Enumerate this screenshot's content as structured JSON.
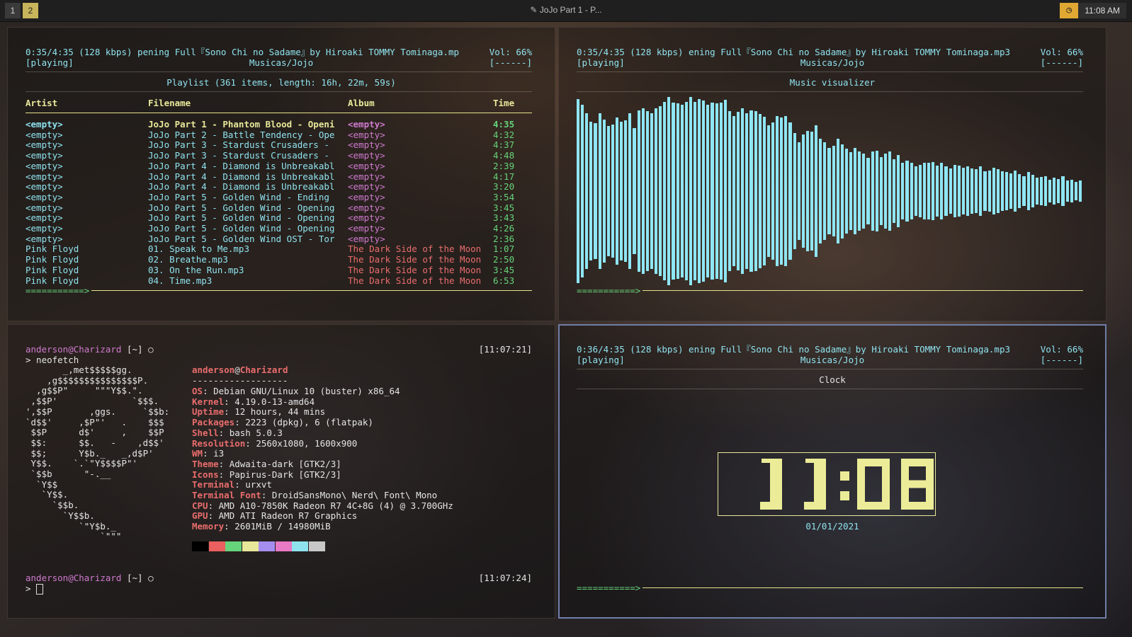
{
  "topbar": {
    "workspaces": [
      "1",
      "2"
    ],
    "window_title": "JoJo Part 1 - P...",
    "time": "11:08 AM",
    "clock_icon": "clock-icon"
  },
  "player_tl": {
    "status_time": "0:35/4:35 (128 kbps)",
    "title": "pening Full『Sono Chi no Sadame』by Hiroaki TOMMY Tominaga.mp",
    "volume": "Vol: 66%",
    "state": "[playing]",
    "dir": "Musicas/Jojo",
    "flags": "[------]",
    "header": "Playlist (361 items, length: 16h, 22m, 59s)",
    "columns": [
      "Artist",
      "Filename",
      "Album",
      "Time"
    ],
    "progress": "===========>",
    "rows": [
      {
        "artist": "<empty>",
        "file": "JoJo Part 1 - Phantom Blood - Openi",
        "album": "<empty>",
        "time": "4:35",
        "current": true
      },
      {
        "artist": "<empty>",
        "file": "JoJo Part 2 - Battle Tendency - Ope",
        "album": "<empty>",
        "time": "4:32"
      },
      {
        "artist": "<empty>",
        "file": "JoJo Part 3 - Stardust Crusaders - ",
        "album": "<empty>",
        "time": "4:37"
      },
      {
        "artist": "<empty>",
        "file": "JoJo Part 3 - Stardust Crusaders - ",
        "album": "<empty>",
        "time": "4:48"
      },
      {
        "artist": "<empty>",
        "file": "JoJo Part 4 - Diamond is Unbreakabl",
        "album": "<empty>",
        "time": "2:39"
      },
      {
        "artist": "<empty>",
        "file": "JoJo Part 4 - Diamond is Unbreakabl",
        "album": "<empty>",
        "time": "4:17"
      },
      {
        "artist": "<empty>",
        "file": "JoJo Part 4 - Diamond is Unbreakabl",
        "album": "<empty>",
        "time": "3:20"
      },
      {
        "artist": "<empty>",
        "file": "JoJo Part 5 - Golden Wind - Ending ",
        "album": "<empty>",
        "time": "3:54"
      },
      {
        "artist": "<empty>",
        "file": "JoJo Part 5 - Golden Wind - Opening",
        "album": "<empty>",
        "time": "3:45"
      },
      {
        "artist": "<empty>",
        "file": "JoJo Part 5 - Golden Wind - Opening",
        "album": "<empty>",
        "time": "3:43"
      },
      {
        "artist": "<empty>",
        "file": "JoJo Part 5 - Golden Wind - Opening",
        "album": "<empty>",
        "time": "4:26"
      },
      {
        "artist": "<empty>",
        "file": "JoJo Part 5 - Golden Wind OST - Tor",
        "album": "<empty>",
        "time": "2:36"
      },
      {
        "artist": "Pink Floyd",
        "file": "01. Speak to Me.mp3",
        "album": "The Dark Side of the Moon",
        "time": "1:07"
      },
      {
        "artist": "Pink Floyd",
        "file": "02. Breathe.mp3",
        "album": "The Dark Side of the Moon",
        "time": "2:50"
      },
      {
        "artist": "Pink Floyd",
        "file": "03. On the Run.mp3",
        "album": "The Dark Side of the Moon",
        "time": "3:45"
      },
      {
        "artist": "Pink Floyd",
        "file": "04. Time.mp3",
        "album": "The Dark Side of the Moon",
        "time": "6:53"
      }
    ]
  },
  "player_tr": {
    "status_time": "0:35/4:35 (128 kbps)",
    "title": "ening Full『Sono Chi no Sadame』by Hiroaki TOMMY Tominaga.mp3",
    "volume": "Vol: 66%",
    "state": "[playing]",
    "dir": "Musicas/Jojo",
    "flags": "[------]",
    "header": "Music visualizer",
    "progress": "===========>",
    "bar_color": "#8fe6f4",
    "levels": [
      0.98,
      0.92,
      0.83,
      0.74,
      0.72,
      0.83,
      0.76,
      0.69,
      0.71,
      0.78,
      0.74,
      0.75,
      0.83,
      0.67,
      0.86,
      0.88,
      0.85,
      0.83,
      0.88,
      0.9,
      0.95,
      1.0,
      0.94,
      0.93,
      0.92,
      0.95,
      1.0,
      0.95,
      0.98,
      0.96,
      0.92,
      0.94,
      0.93,
      0.94,
      0.97,
      0.85,
      0.8,
      0.84,
      0.88,
      0.83,
      0.86,
      0.85,
      0.82,
      0.79,
      0.7,
      0.73,
      0.8,
      0.78,
      0.8,
      0.73,
      0.62,
      0.52,
      0.6,
      0.64,
      0.63,
      0.7,
      0.56,
      0.52,
      0.46,
      0.48,
      0.56,
      0.5,
      0.45,
      0.41,
      0.46,
      0.42,
      0.4,
      0.35,
      0.42,
      0.43,
      0.36,
      0.4,
      0.42,
      0.34,
      0.38,
      0.3,
      0.32,
      0.3,
      0.26,
      0.28,
      0.3,
      0.3,
      0.31,
      0.27,
      0.3,
      0.26,
      0.24,
      0.28,
      0.27,
      0.25,
      0.26,
      0.24,
      0.23,
      0.26,
      0.21,
      0.22,
      0.25,
      0.23,
      0.21,
      0.2,
      0.19,
      0.22,
      0.18,
      0.16,
      0.2,
      0.17,
      0.14,
      0.15,
      0.16,
      0.12,
      0.14,
      0.13,
      0.16,
      0.11,
      0.12,
      0.1,
      0.11
    ]
  },
  "terminal": {
    "prompt1_user": "anderson@Charizard",
    "prompt1_dir": " [~] ",
    "prompt_symbol": "○",
    "prompt1_time": "[11:07:21]",
    "command": "> neofetch",
    "ascii": [
      "       _,met$$$$$gg.",
      "    ,g$$$$$$$$$$$$$$$P.",
      "  ,g$$P\"     \"\"\"Y$$.\".",
      " ,$$P'              `$$$.",
      "',$$P       ,ggs.     `$$b:",
      "`d$$'     ,$P\"'   .    $$$",
      " $$P      d$'     ,    $$P",
      " $$:      $$.   -    ,d$$'",
      " $$;      Y$b._   _,d$P'",
      " Y$$.    `.`\"Y$$$$P\"'",
      " `$$b      \"-.__",
      "  `Y$$",
      "   `Y$$.",
      "     `$$b.",
      "       `Y$$b.",
      "          `\"Y$b._",
      "              `\"\"\""
    ],
    "info_user": "anderson",
    "info_at": "@",
    "info_host": "Charizard",
    "info_sep": "------------------",
    "info": [
      {
        "k": "OS",
        "v": "Debian GNU/Linux 10 (buster) x86_64"
      },
      {
        "k": "Kernel",
        "v": "4.19.0-13-amd64"
      },
      {
        "k": "Uptime",
        "v": "12 hours, 44 mins"
      },
      {
        "k": "Packages",
        "v": "2223 (dpkg), 6 (flatpak)"
      },
      {
        "k": "Shell",
        "v": "bash 5.0.3"
      },
      {
        "k": "Resolution",
        "v": "2560x1080, 1600x900"
      },
      {
        "k": "WM",
        "v": "i3"
      },
      {
        "k": "Theme",
        "v": "Adwaita-dark [GTK2/3]"
      },
      {
        "k": "Icons",
        "v": "Papirus-Dark [GTK2/3]"
      },
      {
        "k": "Terminal",
        "v": "urxvt"
      },
      {
        "k": "Terminal Font",
        "v": "DroidSansMono\\ Nerd\\ Font\\ Mono"
      },
      {
        "k": "CPU",
        "v": "AMD A10-7850K Radeon R7 4C+8G (4) @ 3.700GHz"
      },
      {
        "k": "GPU",
        "v": "AMD ATI Radeon R7 Graphics"
      },
      {
        "k": "Memory",
        "v": "2601MiB / 14980MiB"
      }
    ],
    "palette": [
      "#000000",
      "#ea5f5f",
      "#66d47a",
      "#e8e89a",
      "#a58ef0",
      "#e879c5",
      "#8fe3ef",
      "#c8c8c8"
    ],
    "prompt2_user": "anderson@Charizard",
    "prompt2_dir": " [~] ",
    "prompt2_time": "[11:07:24]",
    "prompt2_cmd": "> "
  },
  "player_br": {
    "status_time": "0:36/4:35 (128 kbps)",
    "title": "ening Full『Sono Chi no Sadame』by Hiroaki TOMMY Tominaga.mp3",
    "volume": "Vol: 66%",
    "state": "[playing]",
    "dir": "Musicas/Jojo",
    "flags": "[------]",
    "header": "Clock",
    "clock": "11:08",
    "date": "01/01/2021",
    "progress": "===========>"
  }
}
